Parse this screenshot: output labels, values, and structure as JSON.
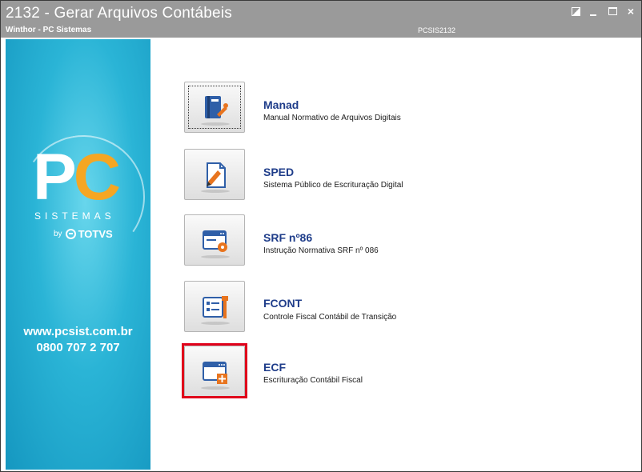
{
  "window": {
    "title": "2132 - Gerar Arquivos Contábeis",
    "subtitle": "Winthor - PC Sistemas",
    "program_code": "PCSIS2132",
    "controls": {
      "minimize": "_",
      "close": "×"
    }
  },
  "sidebar": {
    "logo": {
      "pc": "P",
      "pc_c": "C",
      "sistemas": "SISTEMAS",
      "by": "by",
      "totvs": "TOTVS"
    },
    "website": "www.pcsist.com.br",
    "phone": "0800 707 2 707"
  },
  "items": [
    {
      "title": "Manad",
      "description": "Manual Normativo de Arquivos Digitais",
      "icon": "book-wrench-icon"
    },
    {
      "title": "SPED",
      "description": "Sistema Público de Escrituração Digital",
      "icon": "document-pen-icon"
    },
    {
      "title": "SRF nº86",
      "description": "Instrução Normativa SRF nº 086",
      "icon": "window-gear-icon"
    },
    {
      "title": "FCONT",
      "description": "Controle Fiscal Contábil de Transição",
      "icon": "form-wrench-icon"
    },
    {
      "title": "ECF",
      "description": "Escrituração Contábil Fiscal",
      "icon": "window-plus-icon"
    }
  ],
  "colors": {
    "titlebar": "#9a9a9a",
    "sidebar": "#2ab4d6",
    "item_title": "#1f3d8a",
    "highlight": "#e0001b",
    "logo_accent": "#f5a623"
  }
}
